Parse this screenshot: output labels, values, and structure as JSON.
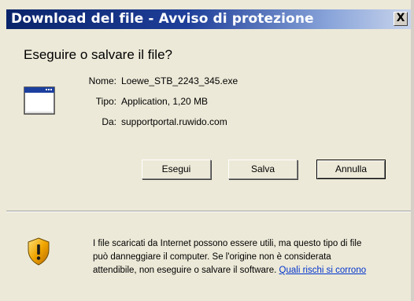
{
  "window": {
    "title": "Download del file - Avviso di protezione",
    "close_label": "X"
  },
  "question": "Eseguire o salvare il file?",
  "file": {
    "icon": "application-window-icon",
    "name_label": "Nome:",
    "name_value": "Loewe_STB_2243_345.exe",
    "type_label": "Tipo:",
    "type_value": "Application, 1,20 MB",
    "from_label": "Da:",
    "from_value": "supportportal.ruwido.com"
  },
  "buttons": {
    "run": "Esegui",
    "save": "Salva",
    "cancel": "Annulla"
  },
  "warning": {
    "icon": "security-shield-warning-icon",
    "text": "I file scaricati da Internet possono essere utili, ma questo tipo di file può danneggiare il computer. Se l'origine non è considerata attendibile, non eseguire o salvare il software.",
    "link": "Quali rischi si corrono"
  },
  "colors": {
    "titlebar_start": "#0a246a",
    "titlebar_end": "#c8d4ec",
    "dialog_bg": "#ece9d8",
    "link": "#0033cc"
  }
}
